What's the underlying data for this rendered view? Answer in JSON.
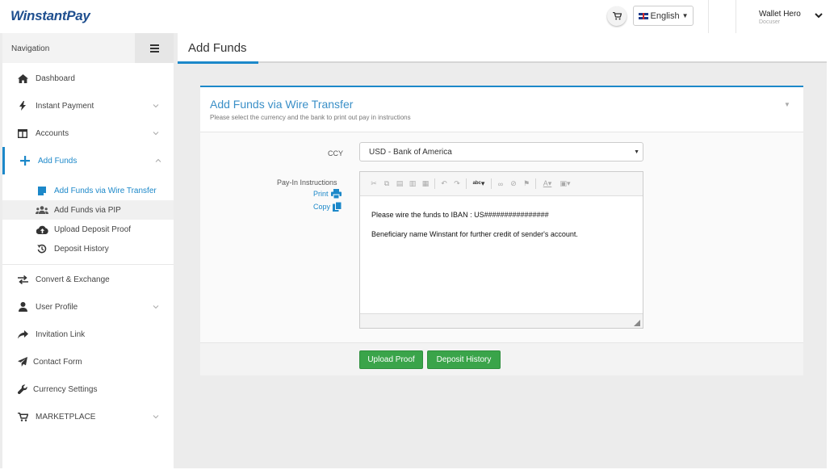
{
  "app": {
    "logo": "WinstantPay"
  },
  "header": {
    "language": "English",
    "user_name": "Wallet Hero",
    "user_role": "Docuser"
  },
  "sidebar": {
    "title": "Navigation",
    "items": [
      {
        "label": "Dashboard",
        "icon": "home-icon"
      },
      {
        "label": "Instant Payment",
        "icon": "bolt-icon"
      },
      {
        "label": "Accounts",
        "icon": "columns-icon"
      },
      {
        "label": "Add Funds",
        "icon": "plus-icon"
      },
      {
        "label": "Convert & Exchange",
        "icon": "exchange-icon"
      },
      {
        "label": "User Profile",
        "icon": "user-icon"
      },
      {
        "label": "Invitation Link",
        "icon": "share-icon"
      },
      {
        "label": "Contact Form",
        "icon": "paper-plane-icon"
      },
      {
        "label": "Currency Settings",
        "icon": "wrench-icon"
      },
      {
        "label": "MARKETPLACE",
        "icon": "cart-icon"
      }
    ],
    "add_funds_sub": [
      {
        "label": "Add Funds via Wire Transfer",
        "icon": "note-icon"
      },
      {
        "label": "Add Funds via PIP",
        "icon": "users-icon"
      },
      {
        "label": "Upload Deposit Proof",
        "icon": "cloud-upload-icon"
      },
      {
        "label": "Deposit History",
        "icon": "history-icon"
      }
    ]
  },
  "page": {
    "title": "Add Funds"
  },
  "panel": {
    "title": "Add Funds via Wire Transfer",
    "subtitle": "Please select the currency and the bank to print out pay in instructions",
    "ccy_label": "CCY",
    "ccy_value": "USD - Bank of America",
    "instructions_label": "Pay-In Instructions",
    "print_label": "Print",
    "copy_label": "Copy",
    "editor_lines": [
      "Please wire the funds to IBAN : US################",
      "Beneficiary name Winstant for further credit of sender's account."
    ],
    "upload_proof_label": "Upload Proof",
    "deposit_history_label": "Deposit History"
  },
  "colors": {
    "accent": "#1c88c9",
    "button_green": "#3aa44a",
    "logo": "#1f4f8f"
  }
}
